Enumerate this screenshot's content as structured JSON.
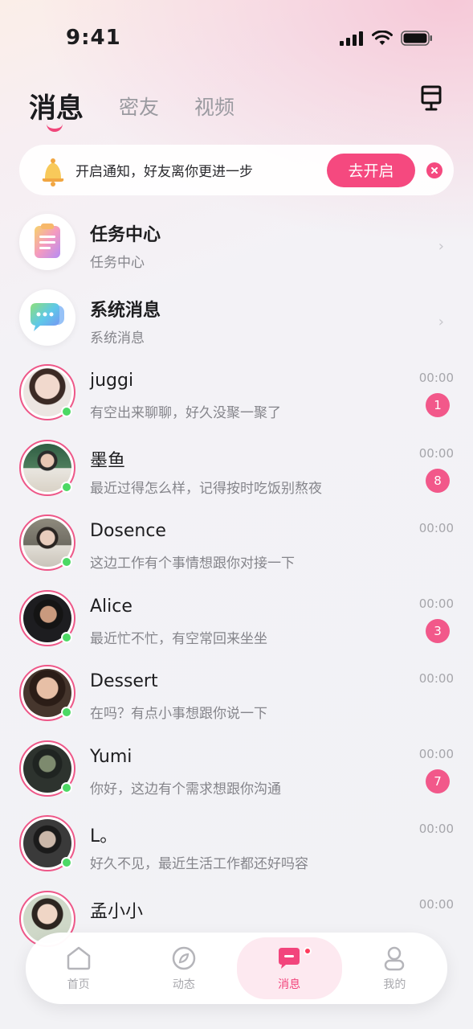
{
  "status_bar": {
    "time": "9:41"
  },
  "tabs": [
    {
      "label": "消息",
      "active": true
    },
    {
      "label": "密友",
      "active": false
    },
    {
      "label": "视频",
      "active": false
    }
  ],
  "notice": {
    "text": "开启通知，好友离你更进一步",
    "button": "去开启"
  },
  "system_items": [
    {
      "name": "任务中心",
      "subtitle": "任务中心",
      "icon": "task-clipboard-icon"
    },
    {
      "name": "系统消息",
      "subtitle": "系统消息",
      "icon": "chat-bubbles-icon"
    }
  ],
  "chats": [
    {
      "name": "juggi",
      "message": "有空出来聊聊，好久没聚一聚了",
      "time": "00:00",
      "unread": "1"
    },
    {
      "name": "墨鱼",
      "message": "最近过得怎么样，记得按时吃饭别熬夜",
      "time": "00:00",
      "unread": "8"
    },
    {
      "name": "Dosence",
      "message": "这边工作有个事情想跟你对接一下",
      "time": "00:00",
      "unread": ""
    },
    {
      "name": "Alice",
      "message": "最近忙不忙，有空常回来坐坐",
      "time": "00:00",
      "unread": "3"
    },
    {
      "name": "Dessert",
      "message": "在吗？有点小事想跟你说一下",
      "time": "00:00",
      "unread": ""
    },
    {
      "name": "Yumi",
      "message": "你好，这边有个需求想跟你沟通",
      "time": "00:00",
      "unread": "7"
    },
    {
      "name": "L。",
      "message": "好久不见，最近生活工作都还好吗容",
      "time": "00:00",
      "unread": ""
    },
    {
      "name": "孟小小",
      "message": "",
      "time": "00:00",
      "unread": ""
    }
  ],
  "tabbar": [
    {
      "label": "首页",
      "icon": "home-icon",
      "active": false
    },
    {
      "label": "动态",
      "icon": "compass-icon",
      "active": false
    },
    {
      "label": "消息",
      "icon": "message-icon",
      "active": true
    },
    {
      "label": "我的",
      "icon": "profile-icon",
      "active": false
    }
  ],
  "colors": {
    "accent": "#f5497f",
    "online": "#4cd964",
    "badge": "#f2588a"
  }
}
